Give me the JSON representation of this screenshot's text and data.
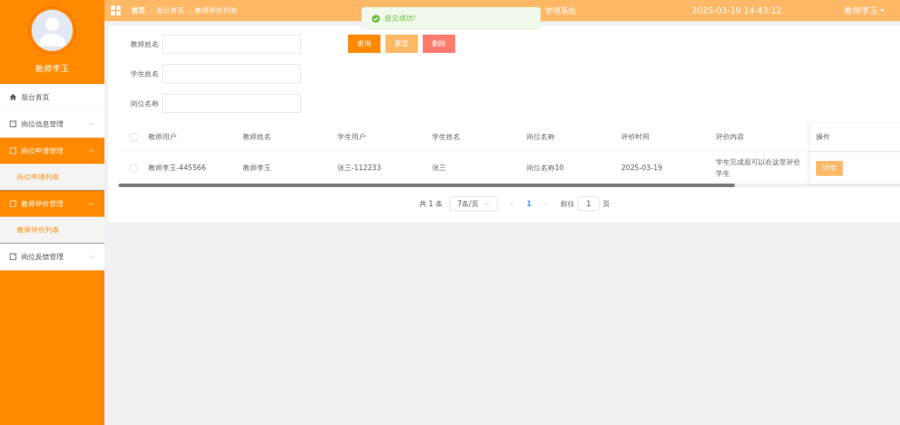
{
  "sidebar": {
    "user_name": "教师李玉",
    "menu": [
      {
        "kind": "home",
        "label": "后台首页"
      },
      {
        "kind": "group",
        "label": "岗位信息管理",
        "expanded": false
      },
      {
        "kind": "group",
        "label": "岗位申请管理",
        "expanded": true,
        "children": [
          {
            "label": "岗位申请列表"
          }
        ]
      },
      {
        "kind": "group",
        "label": "教师评价管理",
        "expanded": true,
        "children": [
          {
            "label": "教师评价列表"
          }
        ]
      },
      {
        "kind": "group",
        "label": "岗位反馈管理",
        "expanded": false
      }
    ]
  },
  "header": {
    "breadcrumb": [
      "首页",
      "后台首页",
      "教师评价列表"
    ],
    "system_title": "管理系统",
    "datetime": "2025-03-19 14:43:12",
    "user": "教师李玉"
  },
  "toast": {
    "message": "提交成功!"
  },
  "search": {
    "fields": [
      {
        "label": "教师姓名"
      },
      {
        "label": "学生姓名"
      },
      {
        "label": "岗位名称"
      }
    ],
    "buttons": [
      {
        "kind": "primary",
        "label": "查询"
      },
      {
        "kind": "light",
        "label": "重置"
      },
      {
        "kind": "danger",
        "label": "删除"
      }
    ]
  },
  "table": {
    "all_checked": false,
    "columns": [
      "教师用户",
      "教师姓名",
      "学生用户",
      "学生姓名",
      "岗位名称",
      "评价时间",
      "评价内容"
    ],
    "action_column": "操作",
    "rows": [
      {
        "checked": false,
        "cells": [
          "教师李玉-445566",
          "教师李玉",
          "张三-112233",
          "张三",
          "岗位名称10",
          "2025-03-19",
          "学生完成后可以在这里评价学生"
        ],
        "action": "详情"
      }
    ]
  },
  "pagination": {
    "total": "共 1 条",
    "page_size": "7条/页",
    "current_page": "1",
    "goto_label": "前往",
    "goto_value": "1",
    "page_unit": "页"
  }
}
